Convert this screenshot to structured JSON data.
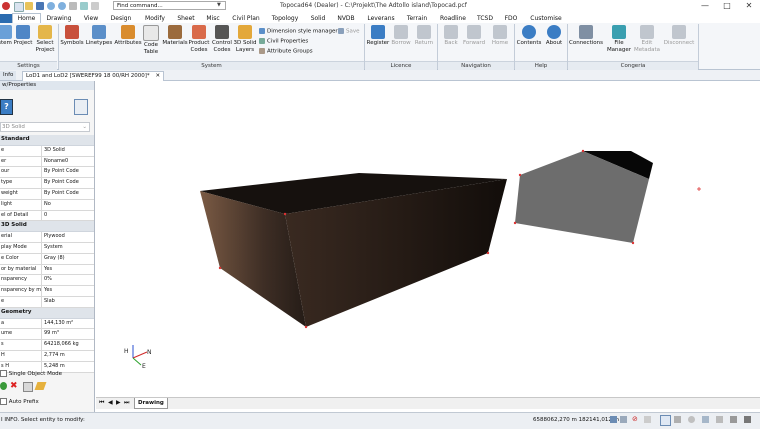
{
  "window": {
    "title": "Topocad64 (Dealer) - C:\\Projekt\\The Adtollo island\\Topocad.pcf",
    "minimize": "—",
    "maximize": "□",
    "close": "✕"
  },
  "quick_access": {
    "find_placeholder": "Find command..."
  },
  "ribbon_tabs": [
    "Home",
    "Drawing",
    "View",
    "Design",
    "Modify",
    "Sheet",
    "Misc",
    "Civil Plan",
    "Topology",
    "Solid",
    "NVDB",
    "Leverans",
    "Terrain",
    "Roadline",
    "TCSD",
    "FDO",
    "Customise"
  ],
  "ribbon": {
    "settings": {
      "label": "Settings",
      "buttons": [
        "stem",
        "Project",
        "Select Project"
      ]
    },
    "system": {
      "label": "System",
      "buttons": [
        "Symbols",
        "Linetypes",
        "Attributes",
        "Code Table",
        "Materials",
        "Product Codes",
        "Control Codes",
        "3D Solid Layers"
      ],
      "small": [
        "Dimension style manager",
        "Civil Properties",
        "Attribute Groups"
      ],
      "save": "Save"
    },
    "licence": {
      "label": "Licence",
      "buttons": [
        "Register",
        "Borrow",
        "Return"
      ]
    },
    "navigation": {
      "label": "Navigation",
      "buttons": [
        "Back",
        "Forward",
        "Home"
      ]
    },
    "help": {
      "label": "Help",
      "buttons": [
        "Contents",
        "About"
      ]
    },
    "congeria": {
      "label": "Congeria",
      "buttons": [
        "Connections",
        "File Manager",
        "Edit Metadata",
        "Disconnect"
      ]
    }
  },
  "doc_tabs": {
    "info": "Info",
    "active": "LoD1 and LoD2 [SWEREF99 18 00/RH 2000]*",
    "close": "✕"
  },
  "left_panel": {
    "header": "w/Properties",
    "type_selector": "3D Solid",
    "categories": [
      {
        "name": "Standard",
        "rows": [
          [
            "e",
            "3D Solid"
          ],
          [
            "er",
            "Noname0"
          ],
          [
            "our",
            "By Point Code"
          ],
          [
            "type",
            "By Point Code"
          ],
          [
            "weight",
            "By Point Code"
          ],
          [
            "light",
            "No"
          ],
          [
            "el of Detail",
            "0"
          ]
        ]
      },
      {
        "name": "3D Solid",
        "rows": [
          [
            "erial",
            "Plywood"
          ],
          [
            "play Mode",
            "System"
          ],
          [
            "e Color",
            "Gray (8)"
          ],
          [
            "or by material",
            "Yes"
          ],
          [
            "nsparency",
            "0%"
          ],
          [
            "nsparency by ma",
            "Yes"
          ],
          [
            "e",
            "Slab"
          ]
        ]
      },
      {
        "name": "Geometry",
        "rows": [
          [
            "a",
            "144,130 m²"
          ],
          [
            "ume",
            "99 m³"
          ],
          [
            "s",
            "64218,066 kg"
          ],
          [
            "H",
            "2,774 m"
          ],
          [
            "s H",
            "5,248 m"
          ]
        ]
      }
    ],
    "single_object_mode": "Single Object Mode",
    "auto_prefix": "Auto Prefix"
  },
  "viewport": {
    "axis_h": "H",
    "axis_n": "N",
    "axis_e": "E",
    "sheet_tab": "Drawing"
  },
  "status": {
    "message": "I INFO. Select entity to modify:",
    "coordinates": "6588062,270 m 182141,012 m"
  },
  "colors": {
    "ribbon_bg": "#f4f6f9",
    "accent": "#2b6cb0",
    "solid_dark": "#1f1712",
    "solid_light": "#7a5a44",
    "right_solid": "#6d6d6d"
  }
}
